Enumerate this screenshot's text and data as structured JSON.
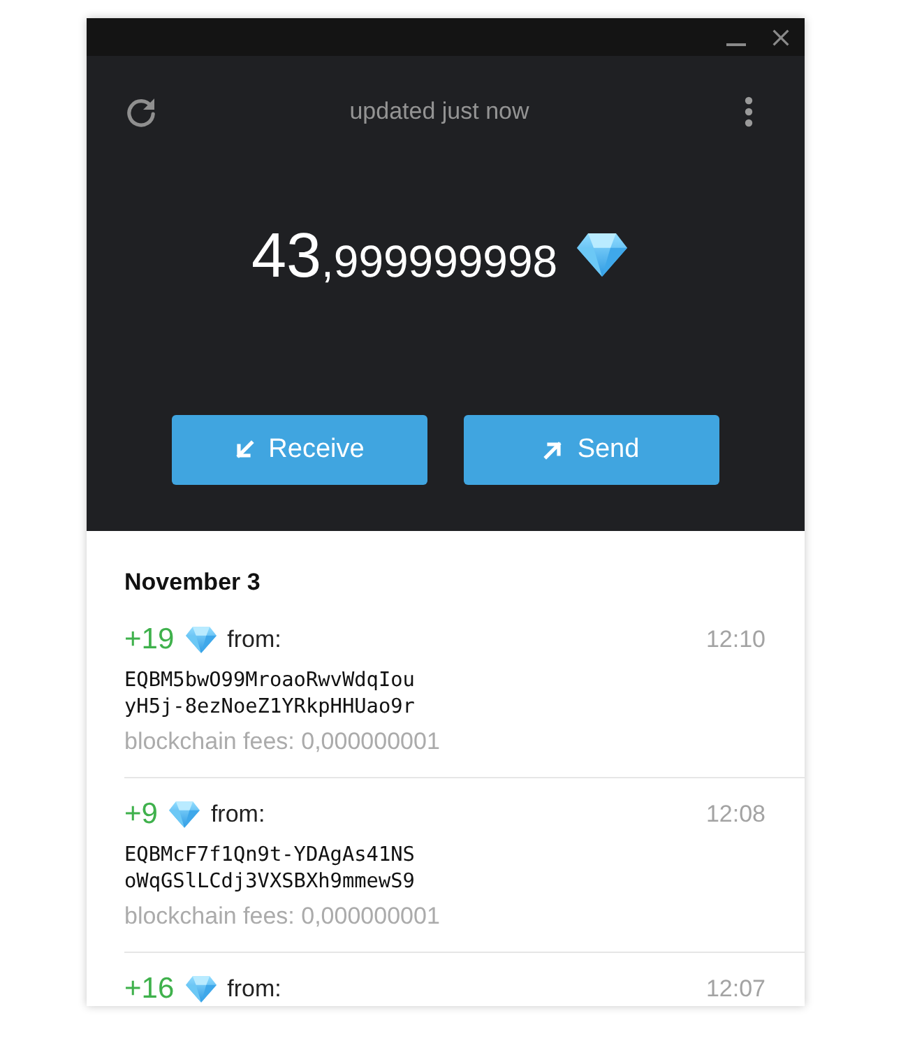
{
  "status": "updated just now",
  "balance": {
    "whole": "43",
    "fraction": ",999999998"
  },
  "actions": [
    {
      "kind": "receive",
      "label": "Receive"
    },
    {
      "kind": "send",
      "label": "Send"
    }
  ],
  "history": {
    "date": "November 3",
    "transactions": [
      {
        "amount": "+19",
        "from_label": "from:",
        "time": "12:10",
        "address_lines": [
          "EQBM5bwO99MroaoRwvWdqIou",
          "yH5j-8ezNoeZ1YRkpHHUao9r"
        ],
        "fee": "blockchain fees: 0,000000001"
      },
      {
        "amount": "+9",
        "from_label": "from:",
        "time": "12:08",
        "address_lines": [
          "EQBMcF7f1Qn9t-YDAgAs41NS",
          "oWqGSlLCdj3VXSBXh9mmewS9"
        ],
        "fee": "blockchain fees: 0,000000001"
      },
      {
        "amount": "+16",
        "from_label": "from:",
        "time": "12:07"
      }
    ]
  }
}
